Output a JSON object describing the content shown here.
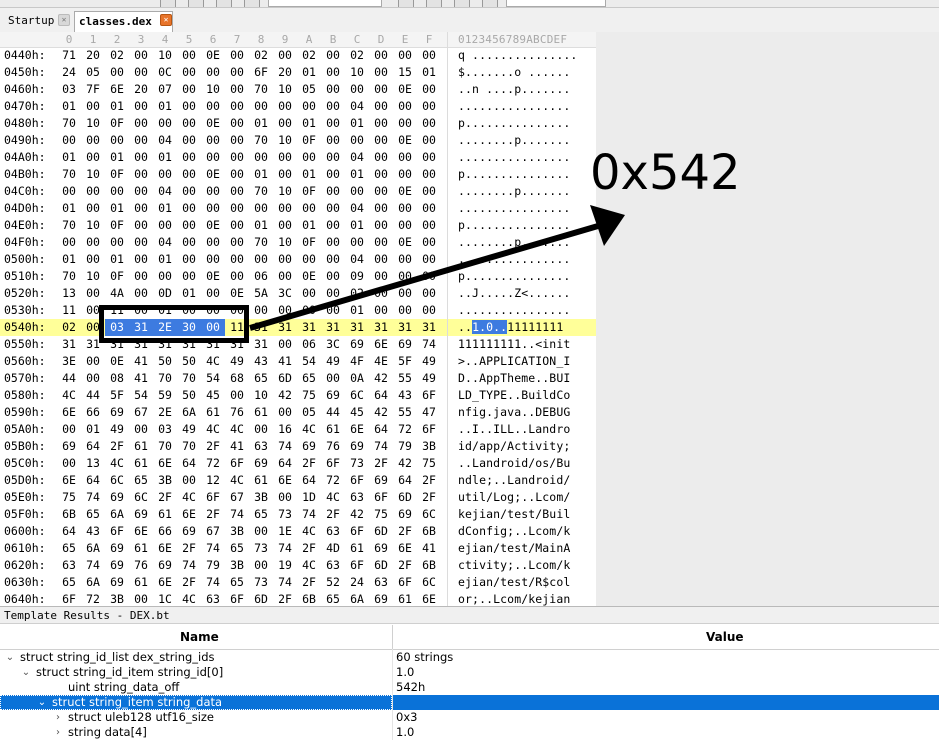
{
  "tabs": [
    {
      "label": "Startup",
      "active": false
    },
    {
      "label": "classes.dex",
      "active": true
    }
  ],
  "hex_view": {
    "columns": [
      "0",
      "1",
      "2",
      "3",
      "4",
      "5",
      "6",
      "7",
      "8",
      "9",
      "A",
      "B",
      "C",
      "D",
      "E",
      "F"
    ],
    "ascii_header": "0123456789ABCDEF",
    "rows": [
      {
        "addr": "0440h:",
        "bytes": [
          "71",
          "20",
          "02",
          "00",
          "10",
          "00",
          "0E",
          "00",
          "02",
          "00",
          "02",
          "00",
          "02",
          "00",
          "00",
          "00"
        ],
        "ascii": "q ..............."
      },
      {
        "addr": "0450h:",
        "bytes": [
          "24",
          "05",
          "00",
          "00",
          "0C",
          "00",
          "00",
          "00",
          "6F",
          "20",
          "01",
          "00",
          "10",
          "00",
          "15",
          "01"
        ],
        "ascii": "$.......o ......"
      },
      {
        "addr": "0460h:",
        "bytes": [
          "03",
          "7F",
          "6E",
          "20",
          "07",
          "00",
          "10",
          "00",
          "70",
          "10",
          "05",
          "00",
          "00",
          "00",
          "0E",
          "00"
        ],
        "ascii": "..n ....p......."
      },
      {
        "addr": "0470h:",
        "bytes": [
          "01",
          "00",
          "01",
          "00",
          "01",
          "00",
          "00",
          "00",
          "00",
          "00",
          "00",
          "00",
          "04",
          "00",
          "00",
          "00"
        ],
        "ascii": "................"
      },
      {
        "addr": "0480h:",
        "bytes": [
          "70",
          "10",
          "0F",
          "00",
          "00",
          "00",
          "0E",
          "00",
          "01",
          "00",
          "01",
          "00",
          "01",
          "00",
          "00",
          "00"
        ],
        "ascii": "p..............."
      },
      {
        "addr": "0490h:",
        "bytes": [
          "00",
          "00",
          "00",
          "00",
          "04",
          "00",
          "00",
          "00",
          "70",
          "10",
          "0F",
          "00",
          "00",
          "00",
          "0E",
          "00"
        ],
        "ascii": "........p......."
      },
      {
        "addr": "04A0h:",
        "bytes": [
          "01",
          "00",
          "01",
          "00",
          "01",
          "00",
          "00",
          "00",
          "00",
          "00",
          "00",
          "00",
          "04",
          "00",
          "00",
          "00"
        ],
        "ascii": "................"
      },
      {
        "addr": "04B0h:",
        "bytes": [
          "70",
          "10",
          "0F",
          "00",
          "00",
          "00",
          "0E",
          "00",
          "01",
          "00",
          "01",
          "00",
          "01",
          "00",
          "00",
          "00"
        ],
        "ascii": "p..............."
      },
      {
        "addr": "04C0h:",
        "bytes": [
          "00",
          "00",
          "00",
          "00",
          "04",
          "00",
          "00",
          "00",
          "70",
          "10",
          "0F",
          "00",
          "00",
          "00",
          "0E",
          "00"
        ],
        "ascii": "........p......."
      },
      {
        "addr": "04D0h:",
        "bytes": [
          "01",
          "00",
          "01",
          "00",
          "01",
          "00",
          "00",
          "00",
          "00",
          "00",
          "00",
          "00",
          "04",
          "00",
          "00",
          "00"
        ],
        "ascii": "................"
      },
      {
        "addr": "04E0h:",
        "bytes": [
          "70",
          "10",
          "0F",
          "00",
          "00",
          "00",
          "0E",
          "00",
          "01",
          "00",
          "01",
          "00",
          "01",
          "00",
          "00",
          "00"
        ],
        "ascii": "p..............."
      },
      {
        "addr": "04F0h:",
        "bytes": [
          "00",
          "00",
          "00",
          "00",
          "04",
          "00",
          "00",
          "00",
          "70",
          "10",
          "0F",
          "00",
          "00",
          "00",
          "0E",
          "00"
        ],
        "ascii": "........p......."
      },
      {
        "addr": "0500h:",
        "bytes": [
          "01",
          "00",
          "01",
          "00",
          "01",
          "00",
          "00",
          "00",
          "00",
          "00",
          "00",
          "00",
          "04",
          "00",
          "00",
          "00"
        ],
        "ascii": "................"
      },
      {
        "addr": "0510h:",
        "bytes": [
          "70",
          "10",
          "0F",
          "00",
          "00",
          "00",
          "0E",
          "00",
          "06",
          "00",
          "0E",
          "00",
          "09",
          "00",
          "00",
          "00"
        ],
        "ascii": "p..............."
      },
      {
        "addr": "0520h:",
        "bytes": [
          "13",
          "00",
          "4A",
          "00",
          "0D",
          "01",
          "00",
          "0E",
          "5A",
          "3C",
          "00",
          "00",
          "02",
          "00",
          "00",
          "00"
        ],
        "ascii": "..J.....Z<......"
      },
      {
        "addr": "0530h:",
        "bytes": [
          "11",
          "00",
          "11",
          "00",
          "01",
          "00",
          "00",
          "00",
          "00",
          "00",
          "00",
          "00",
          "01",
          "00",
          "00",
          "00"
        ],
        "ascii": "................"
      },
      {
        "addr": "0540h:",
        "bytes": [
          "02",
          "00",
          "03",
          "31",
          "2E",
          "30",
          "00",
          "11",
          "31",
          "31",
          "31",
          "31",
          "31",
          "31",
          "31",
          "31"
        ],
        "ascii": "..1.0..11111111",
        "highlight": true,
        "sel_start": 2,
        "sel_end": 6
      },
      {
        "addr": "0550h:",
        "bytes": [
          "31",
          "31",
          "31",
          "31",
          "31",
          "31",
          "31",
          "31",
          "31",
          "00",
          "06",
          "3C",
          "69",
          "6E",
          "69",
          "74"
        ],
        "ascii": "111111111..<init"
      },
      {
        "addr": "0560h:",
        "bytes": [
          "3E",
          "00",
          "0E",
          "41",
          "50",
          "50",
          "4C",
          "49",
          "43",
          "41",
          "54",
          "49",
          "4F",
          "4E",
          "5F",
          "49"
        ],
        "ascii": ">..APPLICATION_I"
      },
      {
        "addr": "0570h:",
        "bytes": [
          "44",
          "00",
          "08",
          "41",
          "70",
          "70",
          "54",
          "68",
          "65",
          "6D",
          "65",
          "00",
          "0A",
          "42",
          "55",
          "49"
        ],
        "ascii": "D..AppTheme..BUI"
      },
      {
        "addr": "0580h:",
        "bytes": [
          "4C",
          "44",
          "5F",
          "54",
          "59",
          "50",
          "45",
          "00",
          "10",
          "42",
          "75",
          "69",
          "6C",
          "64",
          "43",
          "6F"
        ],
        "ascii": "LD_TYPE..BuildCo"
      },
      {
        "addr": "0590h:",
        "bytes": [
          "6E",
          "66",
          "69",
          "67",
          "2E",
          "6A",
          "61",
          "76",
          "61",
          "00",
          "05",
          "44",
          "45",
          "42",
          "55",
          "47"
        ],
        "ascii": "nfig.java..DEBUG"
      },
      {
        "addr": "05A0h:",
        "bytes": [
          "00",
          "01",
          "49",
          "00",
          "03",
          "49",
          "4C",
          "4C",
          "00",
          "16",
          "4C",
          "61",
          "6E",
          "64",
          "72",
          "6F"
        ],
        "ascii": "..I..ILL..Landro"
      },
      {
        "addr": "05B0h:",
        "bytes": [
          "69",
          "64",
          "2F",
          "61",
          "70",
          "70",
          "2F",
          "41",
          "63",
          "74",
          "69",
          "76",
          "69",
          "74",
          "79",
          "3B"
        ],
        "ascii": "id/app/Activity;"
      },
      {
        "addr": "05C0h:",
        "bytes": [
          "00",
          "13",
          "4C",
          "61",
          "6E",
          "64",
          "72",
          "6F",
          "69",
          "64",
          "2F",
          "6F",
          "73",
          "2F",
          "42",
          "75"
        ],
        "ascii": "..Landroid/os/Bu"
      },
      {
        "addr": "05D0h:",
        "bytes": [
          "6E",
          "64",
          "6C",
          "65",
          "3B",
          "00",
          "12",
          "4C",
          "61",
          "6E",
          "64",
          "72",
          "6F",
          "69",
          "64",
          "2F"
        ],
        "ascii": "ndle;..Landroid/"
      },
      {
        "addr": "05E0h:",
        "bytes": [
          "75",
          "74",
          "69",
          "6C",
          "2F",
          "4C",
          "6F",
          "67",
          "3B",
          "00",
          "1D",
          "4C",
          "63",
          "6F",
          "6D",
          "2F"
        ],
        "ascii": "util/Log;..Lcom/"
      },
      {
        "addr": "05F0h:",
        "bytes": [
          "6B",
          "65",
          "6A",
          "69",
          "61",
          "6E",
          "2F",
          "74",
          "65",
          "73",
          "74",
          "2F",
          "42",
          "75",
          "69",
          "6C"
        ],
        "ascii": "kejian/test/Buil"
      },
      {
        "addr": "0600h:",
        "bytes": [
          "64",
          "43",
          "6F",
          "6E",
          "66",
          "69",
          "67",
          "3B",
          "00",
          "1E",
          "4C",
          "63",
          "6F",
          "6D",
          "2F",
          "6B"
        ],
        "ascii": "dConfig;..Lcom/k"
      },
      {
        "addr": "0610h:",
        "bytes": [
          "65",
          "6A",
          "69",
          "61",
          "6E",
          "2F",
          "74",
          "65",
          "73",
          "74",
          "2F",
          "4D",
          "61",
          "69",
          "6E",
          "41"
        ],
        "ascii": "ejian/test/MainA"
      },
      {
        "addr": "0620h:",
        "bytes": [
          "63",
          "74",
          "69",
          "76",
          "69",
          "74",
          "79",
          "3B",
          "00",
          "19",
          "4C",
          "63",
          "6F",
          "6D",
          "2F",
          "6B"
        ],
        "ascii": "ctivity;..Lcom/k"
      },
      {
        "addr": "0630h:",
        "bytes": [
          "65",
          "6A",
          "69",
          "61",
          "6E",
          "2F",
          "74",
          "65",
          "73",
          "74",
          "2F",
          "52",
          "24",
          "63",
          "6F",
          "6C"
        ],
        "ascii": "ejian/test/R$col"
      },
      {
        "addr": "0640h:",
        "bytes": [
          "6F",
          "72",
          "3B",
          "00",
          "1C",
          "4C",
          "63",
          "6F",
          "6D",
          "2F",
          "6B",
          "65",
          "6A",
          "69",
          "61",
          "6E"
        ],
        "ascii": "or;..Lcom/kejian"
      }
    ]
  },
  "annotation": {
    "label": "0x542",
    "color": "#000000"
  },
  "template_results": {
    "title": "Template Results - DEX.bt",
    "col_name": "Name",
    "col_value": "Value",
    "rows": [
      {
        "name": "struct string_id_list dex_string_ids",
        "value": "60 strings",
        "indent": 0,
        "chevron": "expanded",
        "selected": false
      },
      {
        "name": "struct string_id_item string_id[0]",
        "value": "1.0",
        "indent": 1,
        "chevron": "expanded",
        "selected": false
      },
      {
        "name": "uint string_data_off",
        "value": "542h",
        "indent": 3,
        "chevron": "none",
        "selected": false
      },
      {
        "name": "struct string_item string_data",
        "value": "",
        "indent": 2,
        "chevron": "expanded",
        "selected": true
      },
      {
        "name": "struct uleb128 utf16_size",
        "value": "0x3",
        "indent": 3,
        "chevron": "collapsed",
        "selected": false
      },
      {
        "name": "string data[4]",
        "value": "1.0",
        "indent": 3,
        "chevron": "collapsed",
        "selected": false
      }
    ]
  },
  "colors": {
    "selection": "#3d7be0",
    "highlight_row": "#ffff99",
    "tree_selection": "#0a72d8",
    "tab_close_active": "#e8742a"
  }
}
